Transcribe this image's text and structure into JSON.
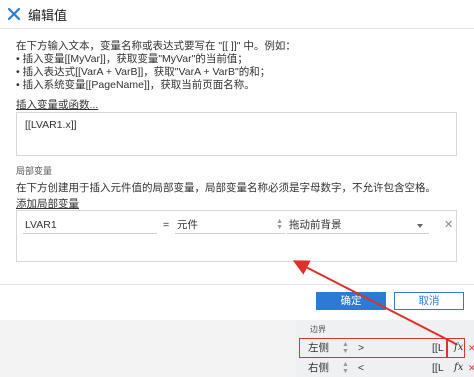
{
  "window": {
    "title": "编辑值",
    "close_glyph": "✕"
  },
  "intro": {
    "lines": [
      "在下方输入文本，变量名称或表达式要写在 \"[[ ]]\" 中。例如：",
      "• 插入变量[[MyVar]]，获取变量\"MyVar\"的当前值；",
      "• 插入表达式[[VarA + VarB]]，获取\"VarA + VarB\"的和；",
      "• 插入系统变量[[PageName]]，获取当前页面名称。"
    ]
  },
  "insert_link": "插入变量或函数...",
  "expression_value": "[[LVAR1.x]]",
  "local_vars": {
    "section_label": "局部变量",
    "description": "在下方创建用于插入元件值的局部变量，局部变量名称必须是字母数字，不允许包含空格。",
    "add_link": "添加局部变量",
    "rows": [
      {
        "name": "LVAR1",
        "eq": "=",
        "type": "元件",
        "target": "拖动前背景",
        "delete": "✕"
      }
    ]
  },
  "buttons": {
    "ok": "确定",
    "cancel": "取消"
  },
  "bottom_panel": {
    "label": "边界",
    "rows": [
      {
        "side": "左侧",
        "op": ">",
        "value": "[[L",
        "fx": "fx",
        "del": "✕"
      },
      {
        "side": "右侧",
        "op": "<",
        "value": "[[L",
        "fx": "fx",
        "del": "✕"
      }
    ]
  },
  "colors": {
    "primary": "#2b7bd4",
    "annotation_red": "#e0302a",
    "logo": "#2b7bd4"
  },
  "icons": [
    "axure-logo-icon",
    "close-icon",
    "updown-spinner-icon",
    "dropdown-arrow-icon",
    "fx-icon",
    "delete-icon"
  ]
}
